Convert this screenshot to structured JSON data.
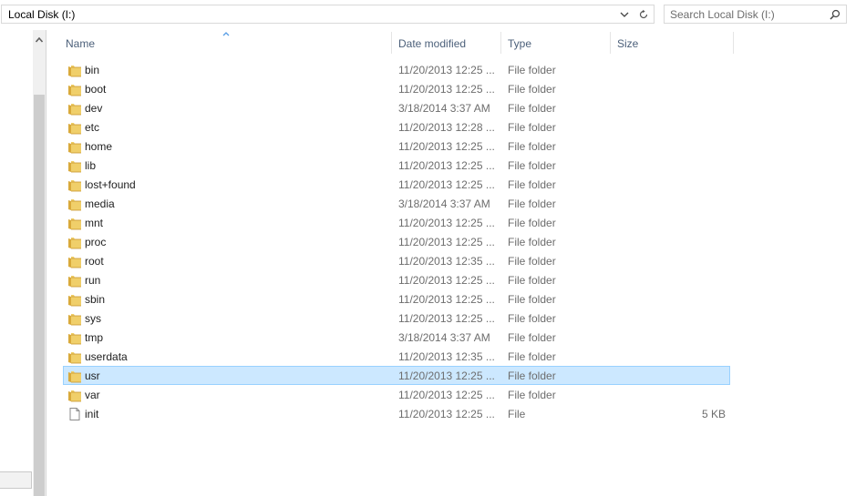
{
  "address": {
    "path": "Local Disk (I:)"
  },
  "search": {
    "placeholder": "Search Local Disk (I:)"
  },
  "columns": {
    "name": "Name",
    "date": "Date modified",
    "type": "Type",
    "size": "Size"
  },
  "files": [
    {
      "name": "bin",
      "date": "11/20/2013 12:25 ...",
      "type": "File folder",
      "size": "",
      "kind": "folder",
      "icon": "folder-icon"
    },
    {
      "name": "boot",
      "date": "11/20/2013 12:25 ...",
      "type": "File folder",
      "size": "",
      "kind": "folder",
      "icon": "folder-icon"
    },
    {
      "name": "dev",
      "date": "3/18/2014 3:37 AM",
      "type": "File folder",
      "size": "",
      "kind": "folder",
      "icon": "folder-icon"
    },
    {
      "name": "etc",
      "date": "11/20/2013 12:28 ...",
      "type": "File folder",
      "size": "",
      "kind": "folder",
      "icon": "folder-icon"
    },
    {
      "name": "home",
      "date": "11/20/2013 12:25 ...",
      "type": "File folder",
      "size": "",
      "kind": "folder",
      "icon": "folder-icon"
    },
    {
      "name": "lib",
      "date": "11/20/2013 12:25 ...",
      "type": "File folder",
      "size": "",
      "kind": "folder",
      "icon": "folder-icon"
    },
    {
      "name": "lost+found",
      "date": "11/20/2013 12:25 ...",
      "type": "File folder",
      "size": "",
      "kind": "folder",
      "icon": "folder-icon"
    },
    {
      "name": "media",
      "date": "3/18/2014 3:37 AM",
      "type": "File folder",
      "size": "",
      "kind": "folder",
      "icon": "folder-icon"
    },
    {
      "name": "mnt",
      "date": "11/20/2013 12:25 ...",
      "type": "File folder",
      "size": "",
      "kind": "folder",
      "icon": "folder-icon"
    },
    {
      "name": "proc",
      "date": "11/20/2013 12:25 ...",
      "type": "File folder",
      "size": "",
      "kind": "folder",
      "icon": "folder-icon"
    },
    {
      "name": "root",
      "date": "11/20/2013 12:35 ...",
      "type": "File folder",
      "size": "",
      "kind": "folder",
      "icon": "folder-icon"
    },
    {
      "name": "run",
      "date": "11/20/2013 12:25 ...",
      "type": "File folder",
      "size": "",
      "kind": "folder",
      "icon": "folder-icon"
    },
    {
      "name": "sbin",
      "date": "11/20/2013 12:25 ...",
      "type": "File folder",
      "size": "",
      "kind": "folder",
      "icon": "folder-icon"
    },
    {
      "name": "sys",
      "date": "11/20/2013 12:25 ...",
      "type": "File folder",
      "size": "",
      "kind": "folder",
      "icon": "folder-icon"
    },
    {
      "name": "tmp",
      "date": "3/18/2014 3:37 AM",
      "type": "File folder",
      "size": "",
      "kind": "folder",
      "icon": "folder-icon"
    },
    {
      "name": "userdata",
      "date": "11/20/2013 12:35 ...",
      "type": "File folder",
      "size": "",
      "kind": "folder",
      "icon": "folder-icon"
    },
    {
      "name": "usr",
      "date": "11/20/2013 12:25 ...",
      "type": "File folder",
      "size": "",
      "kind": "folder",
      "icon": "folder-icon",
      "selected": true
    },
    {
      "name": "var",
      "date": "11/20/2013 12:25 ...",
      "type": "File folder",
      "size": "",
      "kind": "folder",
      "icon": "folder-icon"
    },
    {
      "name": "init",
      "date": "11/20/2013 12:25 ...",
      "type": "File",
      "size": "5 KB",
      "kind": "file",
      "icon": "file-icon"
    }
  ],
  "colors": {
    "selection_bg": "#cce8ff",
    "selection_border": "#99d1ff",
    "header_text": "#4c607a",
    "folder": "#e8c15a"
  }
}
